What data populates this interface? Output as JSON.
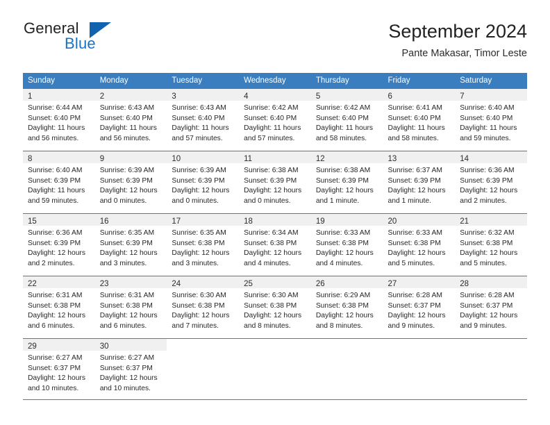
{
  "brand": {
    "word_one": "General",
    "word_two": "Blue",
    "triangle_icon": "blue-triangle-logo-mark",
    "color_dark": "#232323",
    "color_blue": "#1a73c4"
  },
  "header": {
    "title": "September 2024",
    "subtitle": "Pante Makasar, Timor Leste"
  },
  "theme": {
    "header_blue": "#3a7ebf",
    "daynum_band": "#f0f0f0",
    "text": "#262626"
  },
  "calendar": {
    "weekday_headers": [
      "Sunday",
      "Monday",
      "Tuesday",
      "Wednesday",
      "Thursday",
      "Friday",
      "Saturday"
    ],
    "weeks": [
      [
        {
          "day": "1",
          "sunrise": "Sunrise: 6:44 AM",
          "sunset": "Sunset: 6:40 PM",
          "daylight": "Daylight: 11 hours and 56 minutes."
        },
        {
          "day": "2",
          "sunrise": "Sunrise: 6:43 AM",
          "sunset": "Sunset: 6:40 PM",
          "daylight": "Daylight: 11 hours and 56 minutes."
        },
        {
          "day": "3",
          "sunrise": "Sunrise: 6:43 AM",
          "sunset": "Sunset: 6:40 PM",
          "daylight": "Daylight: 11 hours and 57 minutes."
        },
        {
          "day": "4",
          "sunrise": "Sunrise: 6:42 AM",
          "sunset": "Sunset: 6:40 PM",
          "daylight": "Daylight: 11 hours and 57 minutes."
        },
        {
          "day": "5",
          "sunrise": "Sunrise: 6:42 AM",
          "sunset": "Sunset: 6:40 PM",
          "daylight": "Daylight: 11 hours and 58 minutes."
        },
        {
          "day": "6",
          "sunrise": "Sunrise: 6:41 AM",
          "sunset": "Sunset: 6:40 PM",
          "daylight": "Daylight: 11 hours and 58 minutes."
        },
        {
          "day": "7",
          "sunrise": "Sunrise: 6:40 AM",
          "sunset": "Sunset: 6:40 PM",
          "daylight": "Daylight: 11 hours and 59 minutes."
        }
      ],
      [
        {
          "day": "8",
          "sunrise": "Sunrise: 6:40 AM",
          "sunset": "Sunset: 6:39 PM",
          "daylight": "Daylight: 11 hours and 59 minutes."
        },
        {
          "day": "9",
          "sunrise": "Sunrise: 6:39 AM",
          "sunset": "Sunset: 6:39 PM",
          "daylight": "Daylight: 12 hours and 0 minutes."
        },
        {
          "day": "10",
          "sunrise": "Sunrise: 6:39 AM",
          "sunset": "Sunset: 6:39 PM",
          "daylight": "Daylight: 12 hours and 0 minutes."
        },
        {
          "day": "11",
          "sunrise": "Sunrise: 6:38 AM",
          "sunset": "Sunset: 6:39 PM",
          "daylight": "Daylight: 12 hours and 0 minutes."
        },
        {
          "day": "12",
          "sunrise": "Sunrise: 6:38 AM",
          "sunset": "Sunset: 6:39 PM",
          "daylight": "Daylight: 12 hours and 1 minute."
        },
        {
          "day": "13",
          "sunrise": "Sunrise: 6:37 AM",
          "sunset": "Sunset: 6:39 PM",
          "daylight": "Daylight: 12 hours and 1 minute."
        },
        {
          "day": "14",
          "sunrise": "Sunrise: 6:36 AM",
          "sunset": "Sunset: 6:39 PM",
          "daylight": "Daylight: 12 hours and 2 minutes."
        }
      ],
      [
        {
          "day": "15",
          "sunrise": "Sunrise: 6:36 AM",
          "sunset": "Sunset: 6:39 PM",
          "daylight": "Daylight: 12 hours and 2 minutes."
        },
        {
          "day": "16",
          "sunrise": "Sunrise: 6:35 AM",
          "sunset": "Sunset: 6:39 PM",
          "daylight": "Daylight: 12 hours and 3 minutes."
        },
        {
          "day": "17",
          "sunrise": "Sunrise: 6:35 AM",
          "sunset": "Sunset: 6:38 PM",
          "daylight": "Daylight: 12 hours and 3 minutes."
        },
        {
          "day": "18",
          "sunrise": "Sunrise: 6:34 AM",
          "sunset": "Sunset: 6:38 PM",
          "daylight": "Daylight: 12 hours and 4 minutes."
        },
        {
          "day": "19",
          "sunrise": "Sunrise: 6:33 AM",
          "sunset": "Sunset: 6:38 PM",
          "daylight": "Daylight: 12 hours and 4 minutes."
        },
        {
          "day": "20",
          "sunrise": "Sunrise: 6:33 AM",
          "sunset": "Sunset: 6:38 PM",
          "daylight": "Daylight: 12 hours and 5 minutes."
        },
        {
          "day": "21",
          "sunrise": "Sunrise: 6:32 AM",
          "sunset": "Sunset: 6:38 PM",
          "daylight": "Daylight: 12 hours and 5 minutes."
        }
      ],
      [
        {
          "day": "22",
          "sunrise": "Sunrise: 6:31 AM",
          "sunset": "Sunset: 6:38 PM",
          "daylight": "Daylight: 12 hours and 6 minutes."
        },
        {
          "day": "23",
          "sunrise": "Sunrise: 6:31 AM",
          "sunset": "Sunset: 6:38 PM",
          "daylight": "Daylight: 12 hours and 6 minutes."
        },
        {
          "day": "24",
          "sunrise": "Sunrise: 6:30 AM",
          "sunset": "Sunset: 6:38 PM",
          "daylight": "Daylight: 12 hours and 7 minutes."
        },
        {
          "day": "25",
          "sunrise": "Sunrise: 6:30 AM",
          "sunset": "Sunset: 6:38 PM",
          "daylight": "Daylight: 12 hours and 8 minutes."
        },
        {
          "day": "26",
          "sunrise": "Sunrise: 6:29 AM",
          "sunset": "Sunset: 6:38 PM",
          "daylight": "Daylight: 12 hours and 8 minutes."
        },
        {
          "day": "27",
          "sunrise": "Sunrise: 6:28 AM",
          "sunset": "Sunset: 6:37 PM",
          "daylight": "Daylight: 12 hours and 9 minutes."
        },
        {
          "day": "28",
          "sunrise": "Sunrise: 6:28 AM",
          "sunset": "Sunset: 6:37 PM",
          "daylight": "Daylight: 12 hours and 9 minutes."
        }
      ],
      [
        {
          "day": "29",
          "sunrise": "Sunrise: 6:27 AM",
          "sunset": "Sunset: 6:37 PM",
          "daylight": "Daylight: 12 hours and 10 minutes."
        },
        {
          "day": "30",
          "sunrise": "Sunrise: 6:27 AM",
          "sunset": "Sunset: 6:37 PM",
          "daylight": "Daylight: 12 hours and 10 minutes."
        },
        {
          "day": "",
          "sunrise": "",
          "sunset": "",
          "daylight": ""
        },
        {
          "day": "",
          "sunrise": "",
          "sunset": "",
          "daylight": ""
        },
        {
          "day": "",
          "sunrise": "",
          "sunset": "",
          "daylight": ""
        },
        {
          "day": "",
          "sunrise": "",
          "sunset": "",
          "daylight": ""
        },
        {
          "day": "",
          "sunrise": "",
          "sunset": "",
          "daylight": ""
        }
      ]
    ]
  }
}
